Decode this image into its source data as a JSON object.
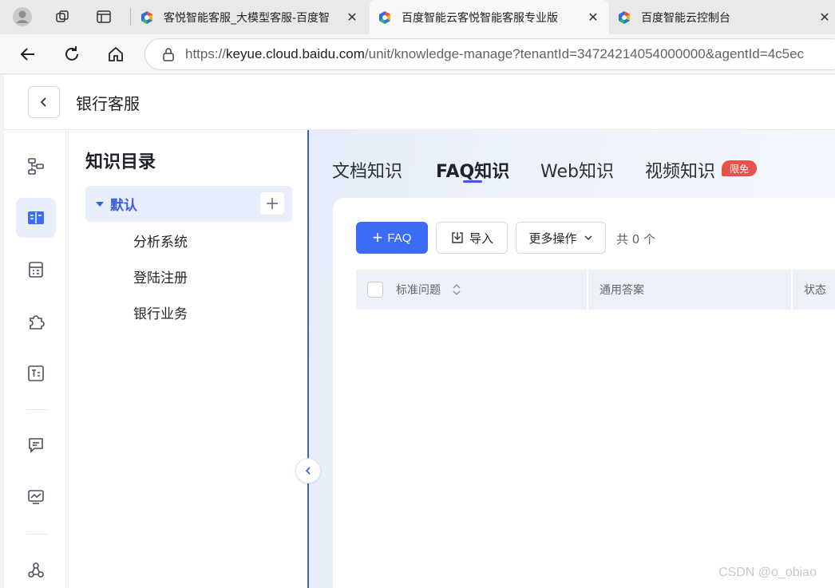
{
  "browser": {
    "tabs": [
      {
        "title": "客悦智能客服_大模型客服-百度智",
        "active": false
      },
      {
        "title": "百度智能云客悦智能客服专业版",
        "active": true
      },
      {
        "title": "百度智能云控制台",
        "active": false
      }
    ],
    "url_prefix": "https://",
    "url_host": "keyue.cloud.baidu.com",
    "url_path": "/unit/knowledge-manage?tenantId=34724214054000000&agentId=4c5ec"
  },
  "app": {
    "title": "银行客服"
  },
  "tree": {
    "heading": "知识目录",
    "root_label": "默认",
    "children": [
      "分析系统",
      "登陆注册",
      "银行业务"
    ]
  },
  "knowledge_tabs": [
    {
      "label": "文档知识",
      "active": false
    },
    {
      "label": "FAQ知识",
      "active": true
    },
    {
      "label": "Web知识",
      "active": false
    },
    {
      "label": "视频知识",
      "active": false
    }
  ],
  "badge": "限免",
  "toolbar": {
    "add_label": "FAQ",
    "import_label": "导入",
    "more_label": "更多操作",
    "count_text": "共 0 个"
  },
  "table": {
    "columns": [
      "标准问题",
      "通用答案",
      "状态"
    ]
  },
  "watermark": "CSDN @o_obiao",
  "colors": {
    "accent": "#3a6cf6",
    "badge": "#e8524a"
  }
}
